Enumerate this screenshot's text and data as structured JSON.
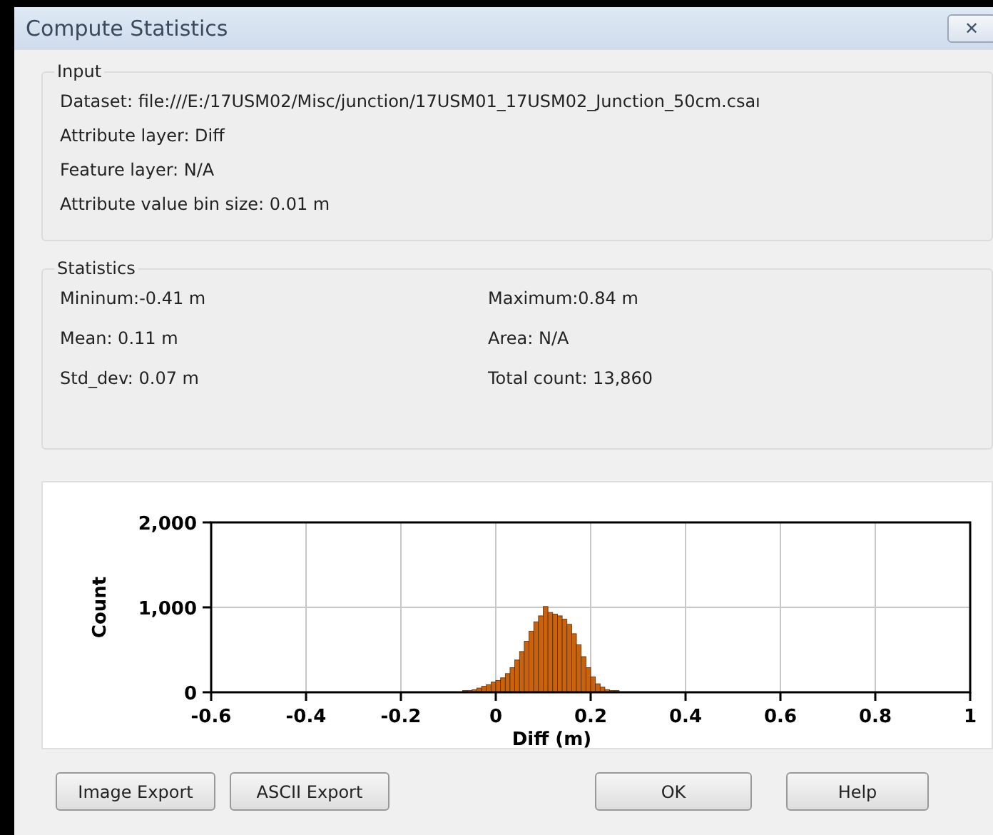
{
  "window": {
    "title": "Compute Statistics",
    "close": "✕"
  },
  "input": {
    "title": "Input",
    "lines": [
      "Dataset: file:///E:/17USM02/Misc/junction/17USM01_17USM02_Junction_50cm.csaı",
      "Attribute layer: Diff",
      "Feature layer: N/A",
      "Attribute value bin size: 0.01 m"
    ]
  },
  "statistics": {
    "title": "Statistics",
    "items": [
      [
        "Mininum:-0.41 m",
        "Maximum:0.84 m"
      ],
      [
        "Mean: 0.11 m",
        "Area: N/A"
      ],
      [
        "Std_dev: 0.07 m",
        "Total count: 13,860"
      ]
    ]
  },
  "histogram": {
    "chart_data": {
      "type": "bar",
      "xlabel": "Diff (m)",
      "ylabel": "Count",
      "xlim": [
        -0.6,
        1
      ],
      "ylim": [
        0,
        2000
      ],
      "xticks": [
        {
          "value": -0.6,
          "label": "-0.6"
        },
        {
          "value": -0.4,
          "label": "-0.4"
        },
        {
          "value": -0.2,
          "label": "-0.2"
        },
        {
          "value": 0,
          "label": "0"
        },
        {
          "value": 0.2,
          "label": "0.2"
        },
        {
          "value": 0.4,
          "label": "0.4"
        },
        {
          "value": 0.6,
          "label": "0.6"
        },
        {
          "value": 0.8,
          "label": "0.8"
        },
        {
          "value": 1,
          "label": "1"
        }
      ],
      "yticks": [
        {
          "value": 0,
          "label": "0"
        },
        {
          "value": 1000,
          "label": "1,000"
        },
        {
          "value": 2000,
          "label": "2,000"
        }
      ],
      "grid": true,
      "x": [
        -0.065,
        -0.055,
        -0.045,
        -0.035,
        -0.025,
        -0.015,
        -0.005,
        0.005,
        0.015,
        0.025,
        0.035,
        0.045,
        0.055,
        0.065,
        0.075,
        0.085,
        0.095,
        0.105,
        0.115,
        0.125,
        0.135,
        0.145,
        0.155,
        0.165,
        0.175,
        0.185,
        0.195,
        0.205,
        0.215,
        0.225,
        0.235,
        0.245,
        0.255
      ],
      "series": [
        {
          "color": "#c8620c",
          "values": [
            20,
            20,
            30,
            50,
            70,
            90,
            120,
            140,
            170,
            220,
            290,
            380,
            480,
            600,
            720,
            830,
            900,
            1010,
            940,
            920,
            900,
            860,
            800,
            690,
            560,
            420,
            290,
            180,
            100,
            60,
            30,
            20,
            20
          ]
        }
      ]
    }
  },
  "buttons": [
    "Image Export",
    "ASCII Export",
    "OK",
    "Help"
  ]
}
